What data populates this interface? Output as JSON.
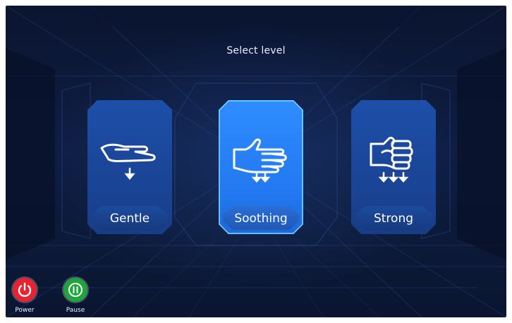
{
  "title": "Select level",
  "levels": [
    {
      "label": "Gentle",
      "icon": "open-hand-flat-icon",
      "arrows": 1,
      "selected": false
    },
    {
      "label": "Soothing",
      "icon": "open-hand-up-icon",
      "arrows": 2,
      "selected": true
    },
    {
      "label": "Strong",
      "icon": "fist-icon",
      "arrows": 3,
      "selected": false
    }
  ],
  "controls": {
    "power": {
      "label": "Power",
      "icon": "power-icon",
      "color": "#e8222e"
    },
    "pause": {
      "label": "Pause",
      "icon": "pause-icon",
      "color": "#1fa63a"
    }
  },
  "colors": {
    "accent": "#2f8dff",
    "card": "#1d4fa9",
    "background": "#0e1d42"
  }
}
